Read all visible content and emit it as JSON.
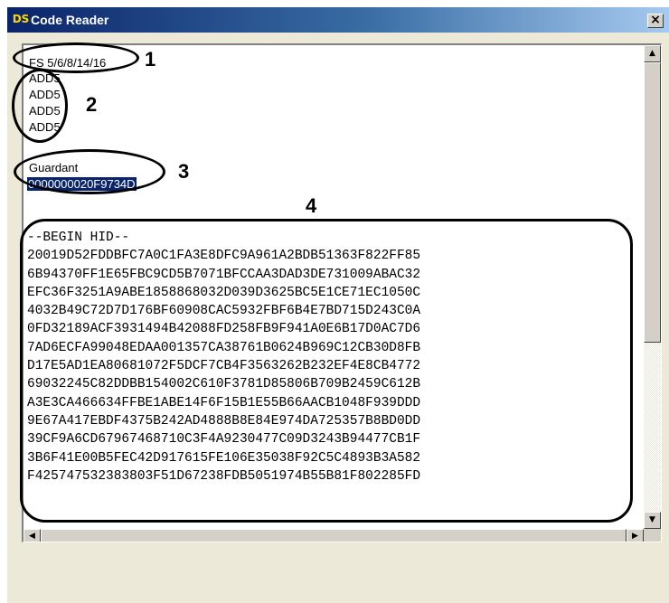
{
  "window": {
    "title": "Code Reader",
    "logo_text": "DS",
    "close_glyph": "×",
    "icons": [
      "app-logo-icon",
      "close-icon"
    ]
  },
  "content": {
    "line1": "FS 5/6/8/14/16",
    "add_lines": [
      "ADD5",
      "ADD5",
      "ADD5",
      "ADD5"
    ],
    "guardant_label": "Guardant",
    "guardant_id": "0000000020F9734D",
    "hid_lines": [
      "--BEGIN HID--",
      "20019D52FDDBFC7A0C1FA3E8DFC9A961A2BDB51363F822FF85",
      "6B94370FF1E65FBC9CD5B7071BFCCAA3DAD3DE731009ABAC32",
      "EFC36F3251A9ABE1858868032D039D3625BC5E1CE71EC1050C",
      "4032B49C72D7D176BF60908CAC5932FBF6B4E7BD715D243C0A",
      "0FD32189ACF3931494B42088FD258FB9F941A0E6B17D0AC7D6",
      "7AD6ECFA99048EDAA001357CA38761B0624B969C12CB30D8FB",
      "D17E5AD1EA80681072F5DCF7CB4F3563262B232EF4E8CB4772",
      "69032245C82DDBB154002C610F3781D85806B709B2459C612B",
      "A3E3CA466634FFBE1ABE14F6F15B1E55B66AACB1048F939DDD",
      "9E67A417EBDF4375B242AD4888B8E84E974DA725357B8BD0DD",
      "39CF9A6CD67967468710C3F4A9230477C09D3243B94477CB1F",
      "3B6F41E00B5FEC42D917615FE106E35038F92C5C4893B3A582",
      "F425747532383803F51D67238FDB5051974B55B81F802285FD"
    ]
  },
  "scrollbars": {
    "up_glyph": "▲",
    "down_glyph": "▼",
    "left_glyph": "◀",
    "right_glyph": "▶"
  },
  "callouts": {
    "numbers": [
      "1",
      "2",
      "3",
      "4"
    ]
  }
}
